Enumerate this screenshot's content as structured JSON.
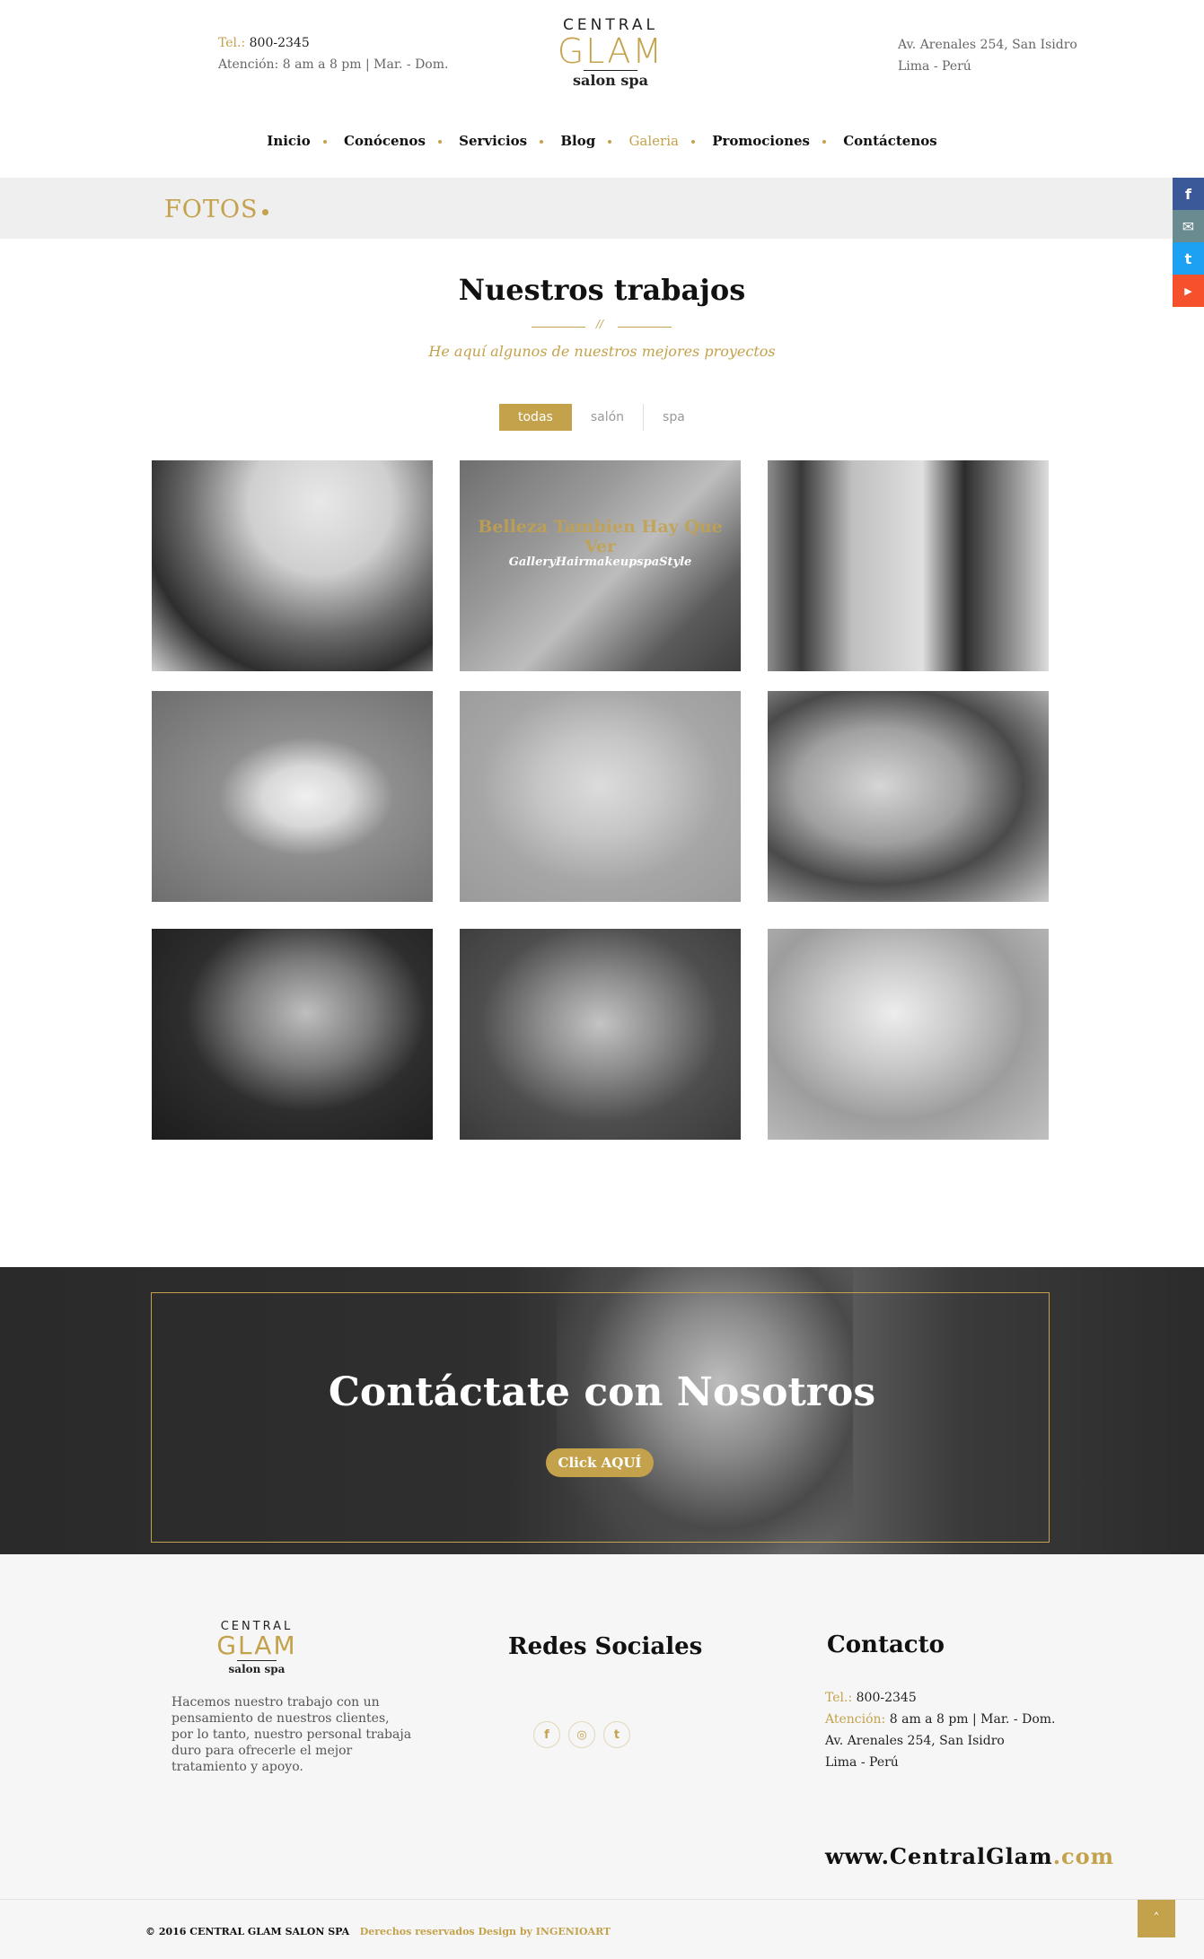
{
  "header": {
    "tel_label": "Tel.:",
    "tel_value": "800-2345",
    "hours": "Atención: 8 am a 8 pm  |  Mar. - Dom.",
    "address_line1": "Av. Arenales  254, San Isidro",
    "address_line2": "Lima - Perú",
    "logo": {
      "line1": "CENTRAL",
      "line2": "GLAM",
      "line3": "salon spa"
    }
  },
  "nav": {
    "items": [
      "Inicio",
      "Conócenos",
      "Servicios",
      "Blog",
      "Galeria",
      "Promociones",
      "Contáctenos"
    ],
    "active": "Galeria"
  },
  "banner": {
    "title": "FOTOS"
  },
  "side_social": [
    {
      "icon": "facebook-icon",
      "glyph": "f",
      "color": "#3b5998"
    },
    {
      "icon": "mail-icon",
      "glyph": "✉",
      "color": "#6a8b90"
    },
    {
      "icon": "twitter-icon",
      "glyph": "t",
      "color": "#1da1f2"
    },
    {
      "icon": "youtube-icon",
      "glyph": "▶",
      "color": "#f4512c"
    }
  ],
  "section": {
    "title": "Nuestros trabajos",
    "separator": "//",
    "subtitle": "He aquí algunos de nuestros mejores proyectos"
  },
  "filters": [
    "todas",
    "salón",
    "spa"
  ],
  "gallery": {
    "hover_title": "Belleza Tambien Hay Que Ver",
    "hover_caption": "GalleryHairmakeupspaStyle",
    "tiles": [
      {
        "name": "gallery-item-stylist-woman"
      },
      {
        "name": "gallery-item-makeup"
      },
      {
        "name": "gallery-item-stylist-man"
      },
      {
        "name": "gallery-item-white-dress"
      },
      {
        "name": "gallery-item-flower-crown"
      },
      {
        "name": "gallery-item-nails"
      },
      {
        "name": "gallery-item-curly-hair"
      },
      {
        "name": "gallery-item-portrait"
      },
      {
        "name": "gallery-item-long-hair"
      }
    ]
  },
  "cta": {
    "title": "Contáctate con Nosotros",
    "button": "Click AQUÍ"
  },
  "footer": {
    "logo": {
      "line1": "CENTRAL",
      "line2": "GLAM",
      "line3": "salon spa"
    },
    "about": "Hacemos nuestro trabajo con un pensamiento de nuestros clientes, por lo tanto, nuestro personal trabaja duro para ofrecerle el mejor tratamiento y apoyo.",
    "social_title": "Redes Sociales",
    "socials": [
      {
        "icon": "facebook-icon",
        "glyph": "f"
      },
      {
        "icon": "instagram-icon",
        "glyph": "◎"
      },
      {
        "icon": "tumblr-icon",
        "glyph": "t"
      }
    ],
    "contact_title": "Contacto",
    "contact": {
      "tel_label": "Tel.:",
      "tel_value": "800-2345",
      "hours_label": "Atención:",
      "hours_value": "8 am a 8 pm  |  Mar. - Dom.",
      "address_line1": "Av. Arenales  254, San Isidro",
      "address_line2": "Lima - Perú"
    },
    "website_main": "www.CentralGlam",
    "website_tld": ".com",
    "copyright": "© 2016   CENTRAL GLAM SALON SPA",
    "rights": "Derechos reservados Design by INGENIOART"
  },
  "totop": "˄",
  "colors": {
    "accent": "#c4a24c",
    "dark": "#2b2b2b"
  }
}
